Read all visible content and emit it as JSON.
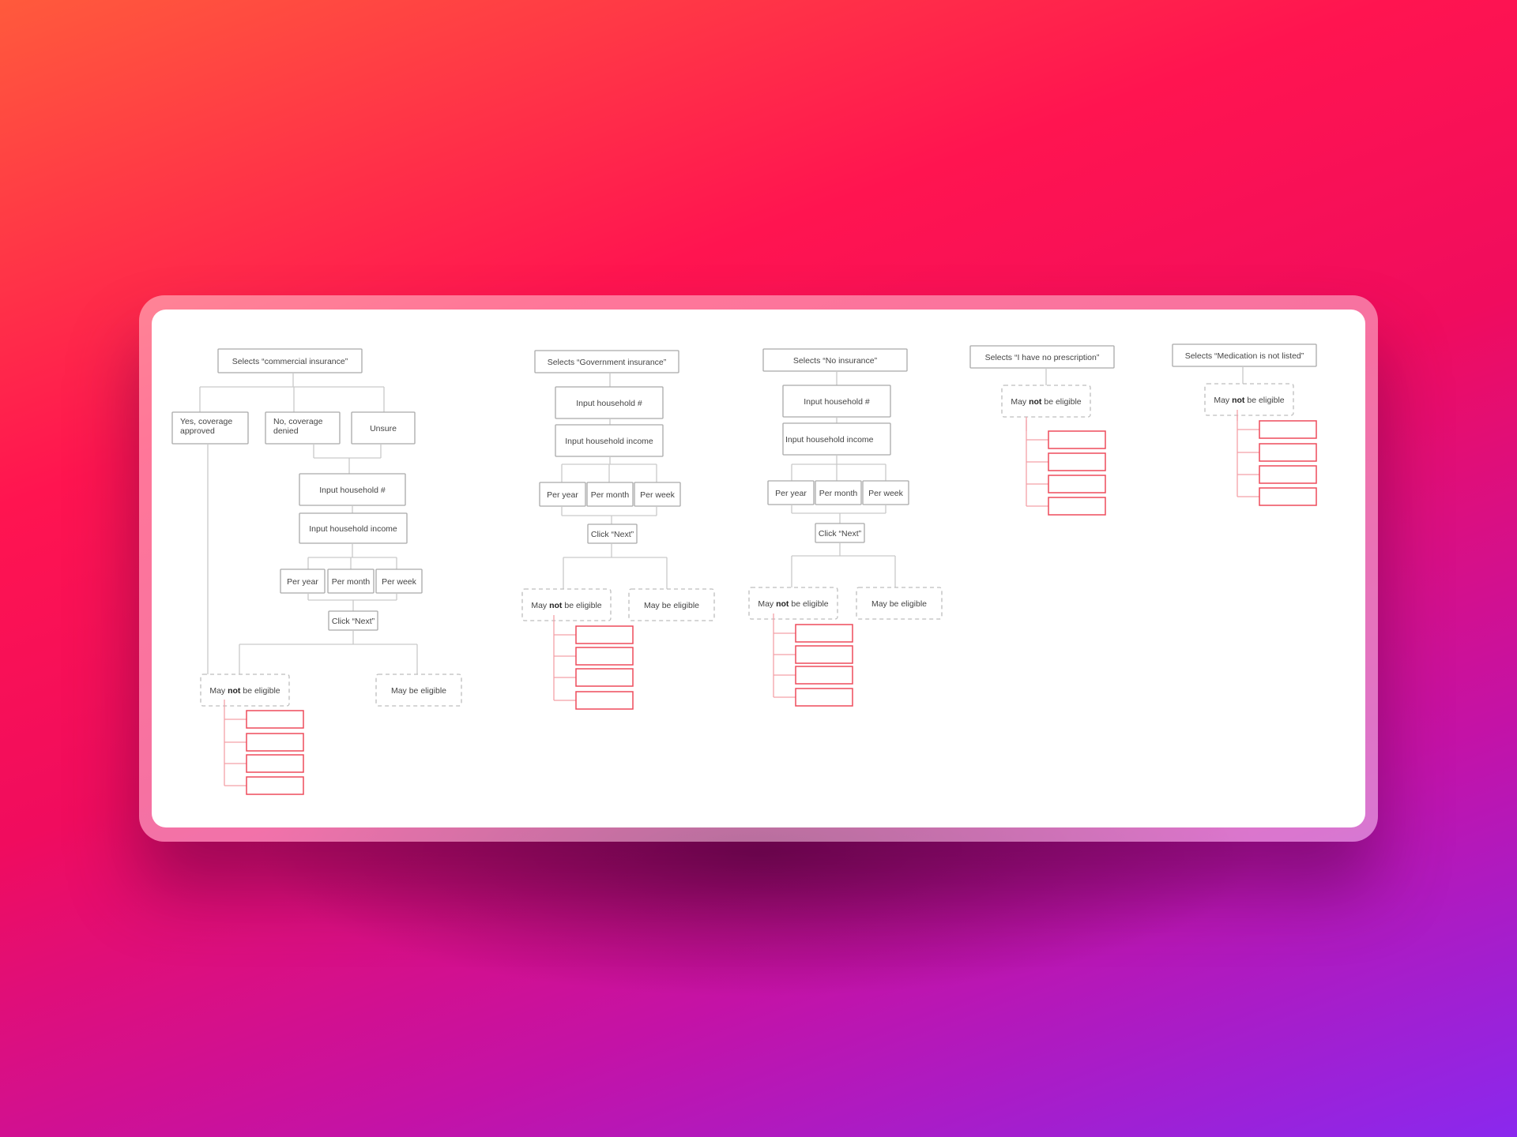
{
  "flows": [
    {
      "id": "commercial",
      "title": "Selects “commercial insurance”",
      "options": [
        "Yes, coverage approved",
        "No, coverage denied",
        "Unsure"
      ],
      "steps": [
        "Input household #",
        "Input household income"
      ],
      "periods": [
        "Per year",
        "Per month",
        "Per week"
      ],
      "next": "Click “Next”",
      "not_eligible": {
        "pre": "May ",
        "strong": "not",
        "post": " be eligible"
      },
      "eligible": "May be eligible",
      "placeholders": 4
    },
    {
      "id": "government",
      "title": "Selects “Government insurance”",
      "steps": [
        "Input household #",
        "Input household income"
      ],
      "periods": [
        "Per year",
        "Per month",
        "Per week"
      ],
      "next": "Click “Next”",
      "not_eligible": {
        "pre": "May ",
        "strong": "not",
        "post": " be eligible"
      },
      "eligible": "May be eligible",
      "placeholders": 4
    },
    {
      "id": "none",
      "title": "Selects “No insurance”",
      "steps": [
        "Input household #",
        "Input household income"
      ],
      "periods": [
        "Per year",
        "Per month",
        "Per week"
      ],
      "next": "Click “Next”",
      "not_eligible": {
        "pre": "May ",
        "strong": "not",
        "post": " be eligible"
      },
      "eligible": "May be eligible",
      "placeholders": 4
    },
    {
      "id": "no-prescription",
      "title": "Selects “I have no prescription”",
      "not_eligible": {
        "pre": "May ",
        "strong": "not",
        "post": " be eligible"
      },
      "placeholders": 4
    },
    {
      "id": "not-listed",
      "title": "Selects “Medication is not listed”",
      "not_eligible": {
        "pre": "May ",
        "strong": "not",
        "post": " be eligible"
      },
      "placeholders": 4
    }
  ],
  "colors": {
    "background_start": "#ff5a3c",
    "background_mid": "#ff1450",
    "background_end": "#8a28ee",
    "node_border": "#a9a9a9",
    "connector": "#c9c9c9",
    "placeholder_border": "#ee4b5b",
    "placeholder_connector": "#f3a0a8"
  }
}
